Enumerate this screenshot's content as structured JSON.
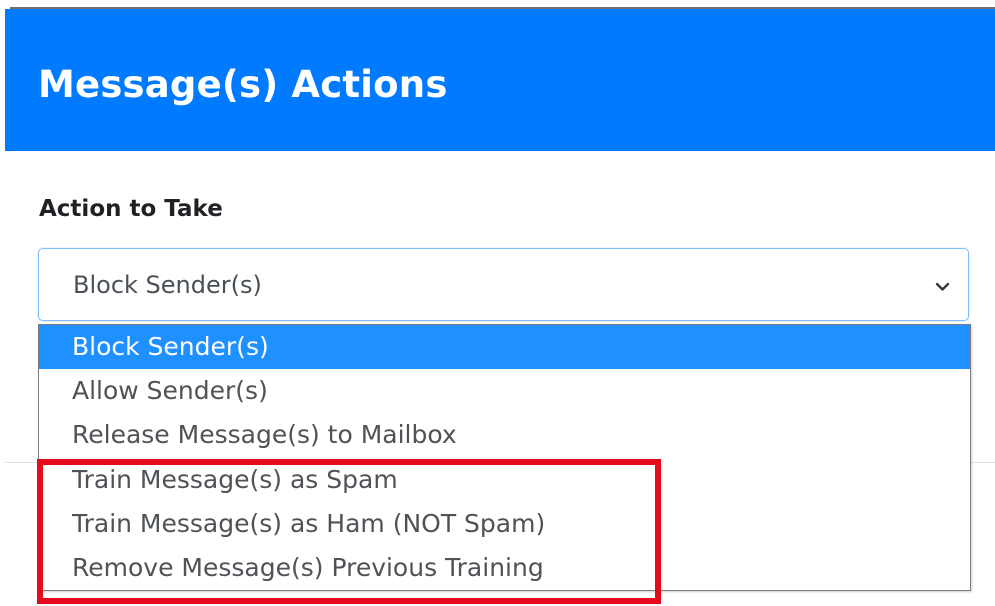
{
  "header": {
    "title": "Message(s) Actions"
  },
  "form": {
    "label": "Action to Take",
    "selected_value": "Block Sender(s)",
    "chevron_icon": "chevron-down-icon"
  },
  "dropdown": {
    "options": [
      {
        "label": "Block Sender(s)",
        "selected": true
      },
      {
        "label": "Allow Sender(s)",
        "selected": false
      },
      {
        "label": "Release Message(s) to Mailbox",
        "selected": false
      },
      {
        "label": "Train Message(s) as Spam",
        "selected": false
      },
      {
        "label": "Train Message(s) as Ham (NOT Spam)",
        "selected": false
      },
      {
        "label": "Remove Message(s) Previous Training",
        "selected": false
      }
    ]
  },
  "colors": {
    "header_background": "#007bff",
    "selected_option_background": "#1e90ff",
    "highlight_outline": "#e60b1c"
  }
}
